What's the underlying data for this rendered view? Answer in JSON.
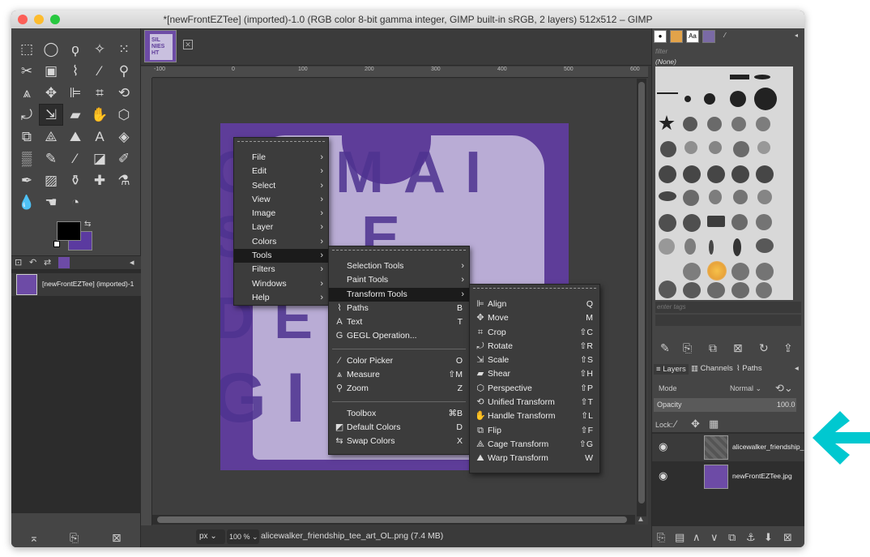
{
  "window": {
    "title": "*[newFrontEZTee] (imported)-1.0 (RGB color 8-bit gamma integer, GIMP built-in sRGB, 2 layers) 512x512 – GIMP"
  },
  "toolbox": {
    "image_row_label": "[newFrontEZTee] (imported)-1"
  },
  "status": {
    "unit": "px",
    "zoom": "100 %",
    "text": "alicewalker_friendship_tee_art_OL.png (7.4 MB)"
  },
  "rulers": {
    "h_ticks": [
      "-100",
      "0",
      "100",
      "200",
      "300",
      "400",
      "500",
      "600"
    ]
  },
  "dock": {
    "filter_placeholder": "filter",
    "brush_none": "(None)",
    "tags_placeholder": "enter tags",
    "tabs": {
      "layers": "Layers",
      "channels": "Channels",
      "paths": "Paths"
    },
    "mode_label": "Mode",
    "mode_value": "Normal",
    "opacity_label": "Opacity",
    "opacity_value": "100.0",
    "lock_label": "Lock:",
    "layers": [
      {
        "name": "alicewalker_friendship_"
      },
      {
        "name": "newFrontEZTee.jpg"
      }
    ],
    "tab_icon_aa": "Aa"
  },
  "main_menu": [
    {
      "label": "File"
    },
    {
      "label": "Edit"
    },
    {
      "label": "Select"
    },
    {
      "label": "View"
    },
    {
      "label": "Image"
    },
    {
      "label": "Layer"
    },
    {
      "label": "Colors"
    },
    {
      "label": "Tools"
    },
    {
      "label": "Filters"
    },
    {
      "label": "Windows"
    },
    {
      "label": "Help"
    }
  ],
  "tools_menu": {
    "submenus": [
      "Selection Tools",
      "Paint Tools",
      "Transform Tools"
    ],
    "items_a": [
      {
        "label": "Paths",
        "shortcut": "B"
      },
      {
        "label": "Text",
        "shortcut": "T"
      },
      {
        "label": "GEGL Operation...",
        "shortcut": ""
      }
    ],
    "items_b": [
      {
        "label": "Color Picker",
        "shortcut": "O"
      },
      {
        "label": "Measure",
        "shortcut": "⇧M"
      },
      {
        "label": "Zoom",
        "shortcut": "Z"
      }
    ],
    "items_c": [
      {
        "label": "Toolbox",
        "shortcut": "⌘B"
      },
      {
        "label": "Default Colors",
        "shortcut": "D"
      },
      {
        "label": "Swap Colors",
        "shortcut": "X"
      }
    ]
  },
  "transform_menu": [
    {
      "label": "Align",
      "shortcut": "Q"
    },
    {
      "label": "Move",
      "shortcut": "M"
    },
    {
      "label": "Crop",
      "shortcut": "⇧C"
    },
    {
      "label": "Rotate",
      "shortcut": "⇧R"
    },
    {
      "label": "Scale",
      "shortcut": "⇧S"
    },
    {
      "label": "Shear",
      "shortcut": "⇧H"
    },
    {
      "label": "Perspective",
      "shortcut": "⇧P"
    },
    {
      "label": "Unified Transform",
      "shortcut": "⇧T"
    },
    {
      "label": "Handle Transform",
      "shortcut": "⇧L"
    },
    {
      "label": "Flip",
      "shortcut": "⇧F"
    },
    {
      "label": "Cage Transform",
      "shortcut": "⇧G"
    },
    {
      "label": "Warp Transform",
      "shortcut": "W"
    }
  ],
  "artwork_text": [
    "OEMAI",
    "SILE",
    "DEI",
    "GI"
  ],
  "thumb_text": [
    "SIL",
    "NIES",
    "HT"
  ],
  "colors": {
    "accent_cyan": "#00c8d0",
    "purple": "#5e3d99",
    "highlight": "#1b1b1b"
  }
}
